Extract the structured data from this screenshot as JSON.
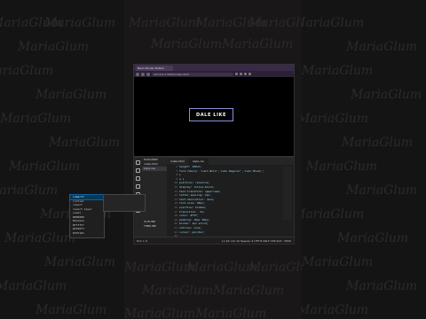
{
  "watermark": "MariaGlum",
  "browser": {
    "tab_title": "Neon Border Button",
    "url": "127.0.0.1:5500/index.html",
    "button_label": "DALE LIKE"
  },
  "editor": {
    "explorer_items": [
      "EXPLORER",
      "index.html",
      "style.css",
      "",
      "OUTLINE",
      "TIMELINE"
    ],
    "tabs": [
      "index.html",
      "style.css"
    ],
    "line_numbers": [
      "6",
      "7",
      "8",
      "9",
      "10",
      "11",
      "12",
      "13",
      "14",
      "15",
      "16",
      "17",
      "18",
      "19",
      "20",
      "21",
      "22",
      "23",
      "24",
      "25"
    ],
    "code_lines": [
      "  height: 100vh;",
      "  font-family: 'Lato Bold','Lato Regular','Lato Black';",
      "}",
      "",
      "a {",
      "  position: relative;",
      "  display: inline-block;",
      "  text-transform: uppercase;",
      "  letter-spacing: 2px;",
      "  text-decoration: none;",
      "  font-size: 20px;",
      "  overflow: hidden;",
      "  transition: .2s;",
      "  color: #fff;",
      "  padding: 10px 30px;",
      "  border: 1px solid;",
      "  outline: none;",
      "  cursor: pointer;",
      "  box-sizing: border-box;",
      "  text-shadow: none;"
    ],
    "suggestions": [
      "inherit",
      "initial",
      "revert",
      "revert-layer",
      "unset",
      "#000000",
      "#1e1e1e",
      "#ffffff",
      "#2196f3",
      "#3f51b5",
      "#9c27b0",
      "#ff9800"
    ],
    "status_left": "⊗ 0 ⚠ 0",
    "status_right": "Ln 22, Col 10  Spaces: 2  UTF-8  CRLF  CSS  Port : 5500"
  }
}
